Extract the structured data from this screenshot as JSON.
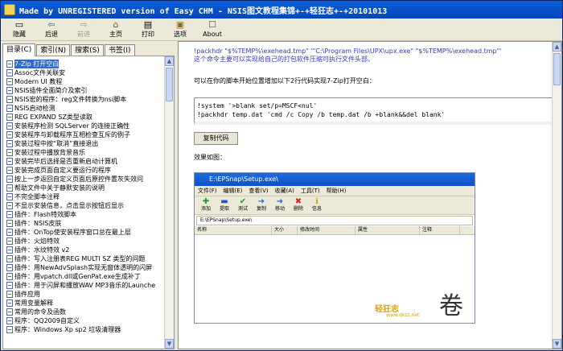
{
  "window": {
    "title": "Made by UNREGISTERED version of Easy CHM - NSIS图文教程集锦+-+轻狂志+-+20101013"
  },
  "toolbar": {
    "buttons": [
      {
        "label": "隐藏",
        "icon": "hide-icon",
        "disabled": false
      },
      {
        "label": "后退",
        "icon": "back-icon",
        "disabled": false
      },
      {
        "label": "前进",
        "icon": "forward-icon",
        "disabled": true
      },
      {
        "label": "主页",
        "icon": "home-icon",
        "disabled": false
      },
      {
        "label": "打印",
        "icon": "print-icon",
        "disabled": false
      },
      {
        "label": "选项",
        "icon": "options-icon",
        "disabled": false
      },
      {
        "label": "About",
        "icon": "about-icon",
        "disabled": false
      }
    ]
  },
  "tabs": [
    "目录(C)",
    "索引(N)",
    "搜索(S)",
    "书签(I)"
  ],
  "tree_items": [
    "7-Zip 打开空白",
    "Assoc文件关联安",
    "Modern UI 教程",
    "NSIS插件全面简介及索引",
    "NSIS宏的程序：reg文件转换为nsi脚本",
    "NSIS启动检测",
    "REG EXPAND SZ类型读取",
    "安装程序检测 SQLServer 的连接正确性",
    "安装程序与卸载程序互相检查互斥的例子",
    "安装过程中按“取消”直接退出",
    "安装过程中播放背景音乐",
    "安装完毕后选择是否重新启动计算机",
    "安装完成页面自定义要运行的程序",
    "按上一步返回自定义页面后原控件置灰失效问",
    "帮助文件中关于静默安装的说明",
    "不完全脚本注释",
    "不显示安装信息，点击显示按钮后显示",
    "插件：Flash特效脚本",
    "插件：NSIS皮肤",
    "插件：OnTop使安装程序窗口总在最上层",
    "插件：火焰特效",
    "插件：水纹特效 v2",
    "插件：写入注册表REG MULTI SZ 类型的问题",
    "插件：用NewAdvSplash实现无窗体透明的闪屏",
    "插件：用vpatch.dll或GenPat.exe生成补丁",
    "插件：用于闪屏和播放WAV MP3音乐的Launche",
    "插件应用",
    "常用变量解释",
    "常用的命令及函数",
    "程序：QQ2009自定义",
    "程序：Windows Xp sp2 垃圾清理器"
  ],
  "selected_item_index": 0,
  "content": {
    "code_lines": [
      "!packhdr \"$%TEMP%\\exehead.tmp\" '\"C:\\Program Files\\UPX\\upx.exe\" \"$%TEMP%\\exehead.tmp\"'",
      "这个命令主要可以实现给自己的打包软件压缩可执行文件头部。"
    ],
    "paragraph": "可以在你的脚本开始位置增加以下2行代码实现7-Zip打开空白：",
    "codebox_lines": [
      "!system '>blank set/p=MSCF<nul'",
      "!packhdr temp.dat 'cmd /c Copy /b temp.dat /b +blank&&del blank'"
    ],
    "copy_button": "复制代码",
    "effect_label": "效果如图：",
    "screenshot": {
      "title": "E:\\EPSnap\\Setup.exe\\",
      "menu": [
        "文件(F)",
        "编辑(E)",
        "查看(V)",
        "收藏(A)",
        "工具(T)",
        "帮助(H)"
      ],
      "tools": [
        {
          "icon": "plus-icon",
          "label": "添加",
          "symbol": "✚",
          "color": "#1e9d2d"
        },
        {
          "icon": "extract-icon",
          "label": "提取",
          "symbol": "▬",
          "color": "#264ec8"
        },
        {
          "icon": "test-icon",
          "label": "测试",
          "symbol": "✔",
          "color": "#1e9d2d"
        },
        {
          "icon": "copy-icon",
          "label": "复制",
          "symbol": "➜",
          "color": "#2a67d6"
        },
        {
          "icon": "move-icon",
          "label": "移动",
          "symbol": "➜",
          "color": "#2a67d6"
        },
        {
          "icon": "delete-icon",
          "label": "删除",
          "symbol": "✖",
          "color": "#d82020"
        },
        {
          "icon": "info-icon",
          "label": "信息",
          "symbol": "ℹ",
          "color": "#d6a20f"
        }
      ],
      "path": "E:\\EPSnap\\Setup.exe\\",
      "columns": [
        "名称",
        "大小",
        "修改时间",
        "属性",
        "注释"
      ],
      "brand": "轻狂志",
      "brand_sub": "www.qkzz.net"
    }
  },
  "colors": {
    "title_start": "#0a5fd8",
    "title_end": "#0447b8",
    "code_blue": "#3838c0",
    "selection": "#316ac5",
    "window_bg": "#ece9d8"
  }
}
